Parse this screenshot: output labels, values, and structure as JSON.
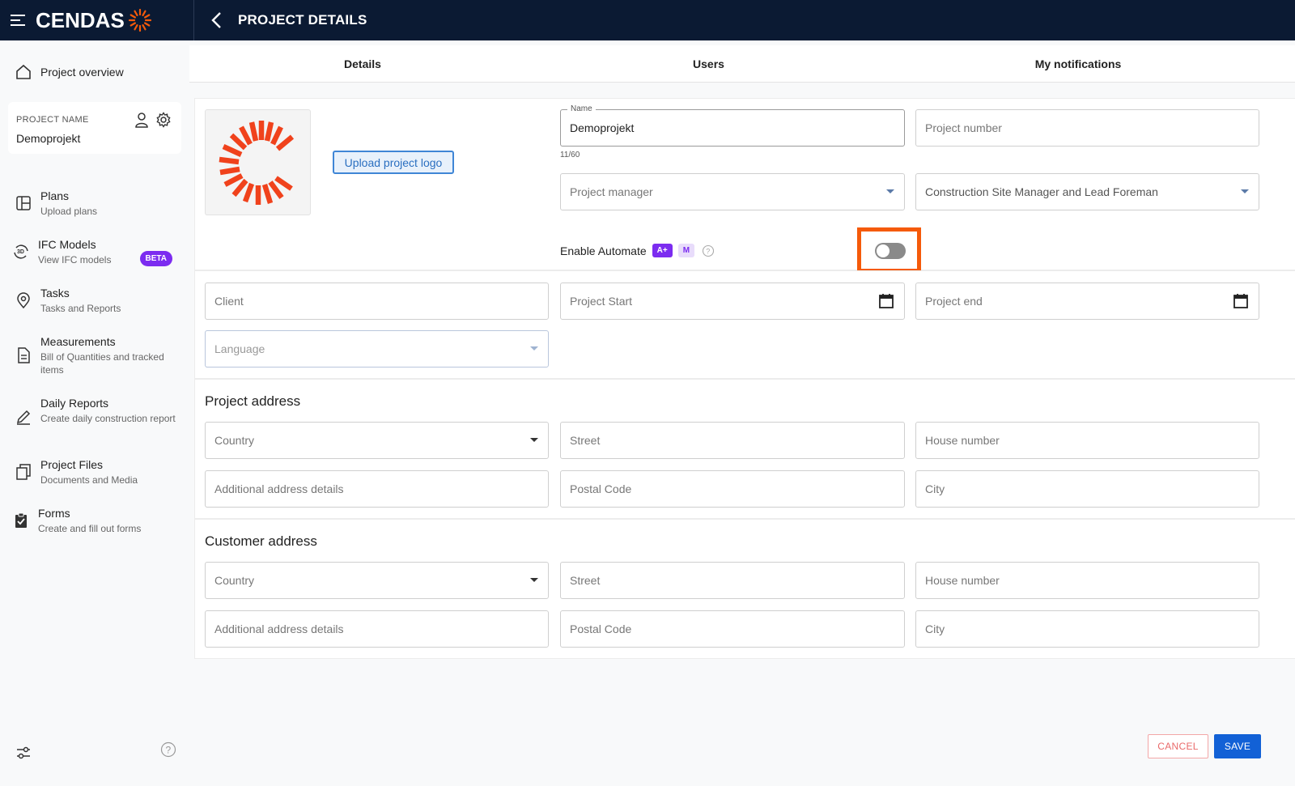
{
  "header": {
    "brand": "CENDAS",
    "title": "PROJECT DETAILS"
  },
  "sidebar": {
    "overview": "Project overview",
    "project_name_label": "PROJECT NAME",
    "project_name": "Demoprojekt",
    "items": [
      {
        "title": "Plans",
        "subtitle": "Upload plans",
        "icon": "plans-icon"
      },
      {
        "title": "IFC Models",
        "subtitle": "View IFC models",
        "icon": "3d-model-icon",
        "badge": "BETA"
      },
      {
        "title": "Tasks",
        "subtitle": "Tasks and Reports",
        "icon": "location-pin-icon"
      },
      {
        "title": "Measurements",
        "subtitle": "Bill of Quantities and tracked items",
        "icon": "document-icon"
      },
      {
        "title": "Daily Reports",
        "subtitle": "Create daily construction report",
        "icon": "pen-icon"
      },
      {
        "title": "Project Files",
        "subtitle": "Documents and Media",
        "icon": "files-icon"
      },
      {
        "title": "Forms",
        "subtitle": "Create and fill out forms",
        "icon": "checklist-icon"
      }
    ]
  },
  "tabs": [
    "Details",
    "Users",
    "My notifications"
  ],
  "details": {
    "upload_logo": "Upload project logo",
    "name_label": "Name",
    "name_value": "Demoprojekt",
    "name_counter": "11/60",
    "project_number": "Project number",
    "project_manager": "Project manager",
    "site_manager": "Construction Site Manager and Lead Foreman",
    "enable_automate": "Enable Automate",
    "badge_a": "A+",
    "badge_m": "M",
    "client": "Client",
    "project_start": "Project Start",
    "project_end": "Project end",
    "language": "Language"
  },
  "project_address": {
    "title": "Project address",
    "country": "Country",
    "street": "Street",
    "house_number": "House number",
    "additional": "Additional address details",
    "postal_code": "Postal Code",
    "city": "City"
  },
  "customer_address": {
    "title": "Customer address",
    "country": "Country",
    "street": "Street",
    "house_number": "House number",
    "additional": "Additional address details",
    "postal_code": "Postal Code",
    "city": "City"
  },
  "footer": {
    "cancel": "CANCEL",
    "save": "SAVE"
  },
  "colors": {
    "topbar": "#0b1a33",
    "accent_orange": "#f55a0a",
    "primary_blue": "#1261d6",
    "purple": "#7c2cf0"
  }
}
